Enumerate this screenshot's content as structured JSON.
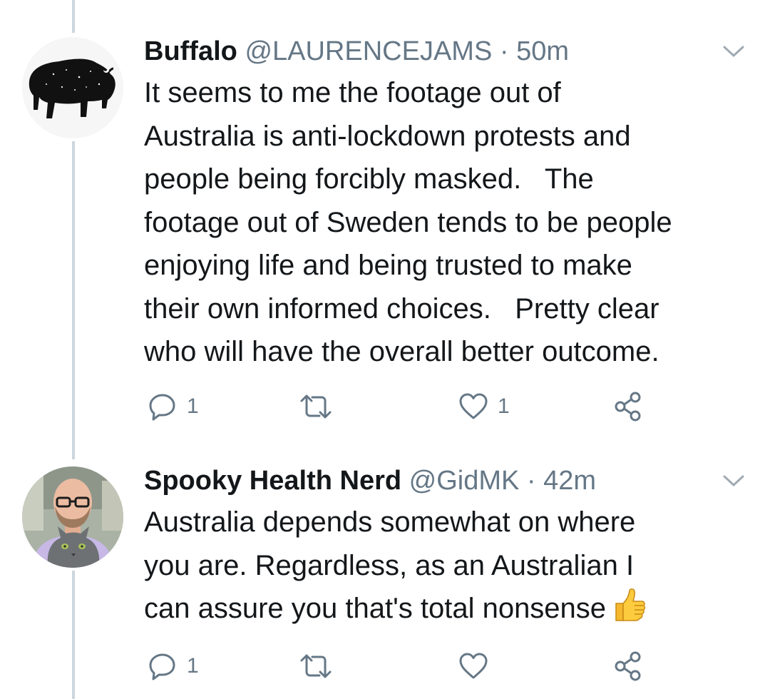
{
  "tweets": [
    {
      "display_name": "Buffalo",
      "handle": "@LAURENCEJAMS",
      "separator": "·",
      "time": "50m",
      "avatar_icon": "buffalo-silhouette",
      "text_lines": [
        "It seems to me the footage out of",
        "Australia is anti-lockdown protests and",
        "people being forcibly masked.   The",
        "footage out of Sweden tends to be people",
        "enjoying life and being trusted to make",
        "their own informed choices.   Pretty clear",
        "who will have the overall better outcome."
      ],
      "actions": {
        "reply_count": "1",
        "retweet_count": "",
        "like_count": "1"
      }
    },
    {
      "display_name": "Spooky Health Nerd",
      "handle": "@GidMK",
      "separator": "·",
      "time": "42m",
      "avatar_icon": "man-with-cat-photo",
      "text_lines": [
        "Australia depends somewhat on where",
        "you are. Regardless, as an Australian I",
        "can assure you that's total nonsense"
      ],
      "emoji": "thumbs-up-icon",
      "actions": {
        "reply_count": "1",
        "retweet_count": "",
        "like_count": ""
      }
    }
  ],
  "colors": {
    "text": "#14171a",
    "secondary": "#657786",
    "thread_line": "#ccd6dd",
    "icon": "#657786"
  }
}
